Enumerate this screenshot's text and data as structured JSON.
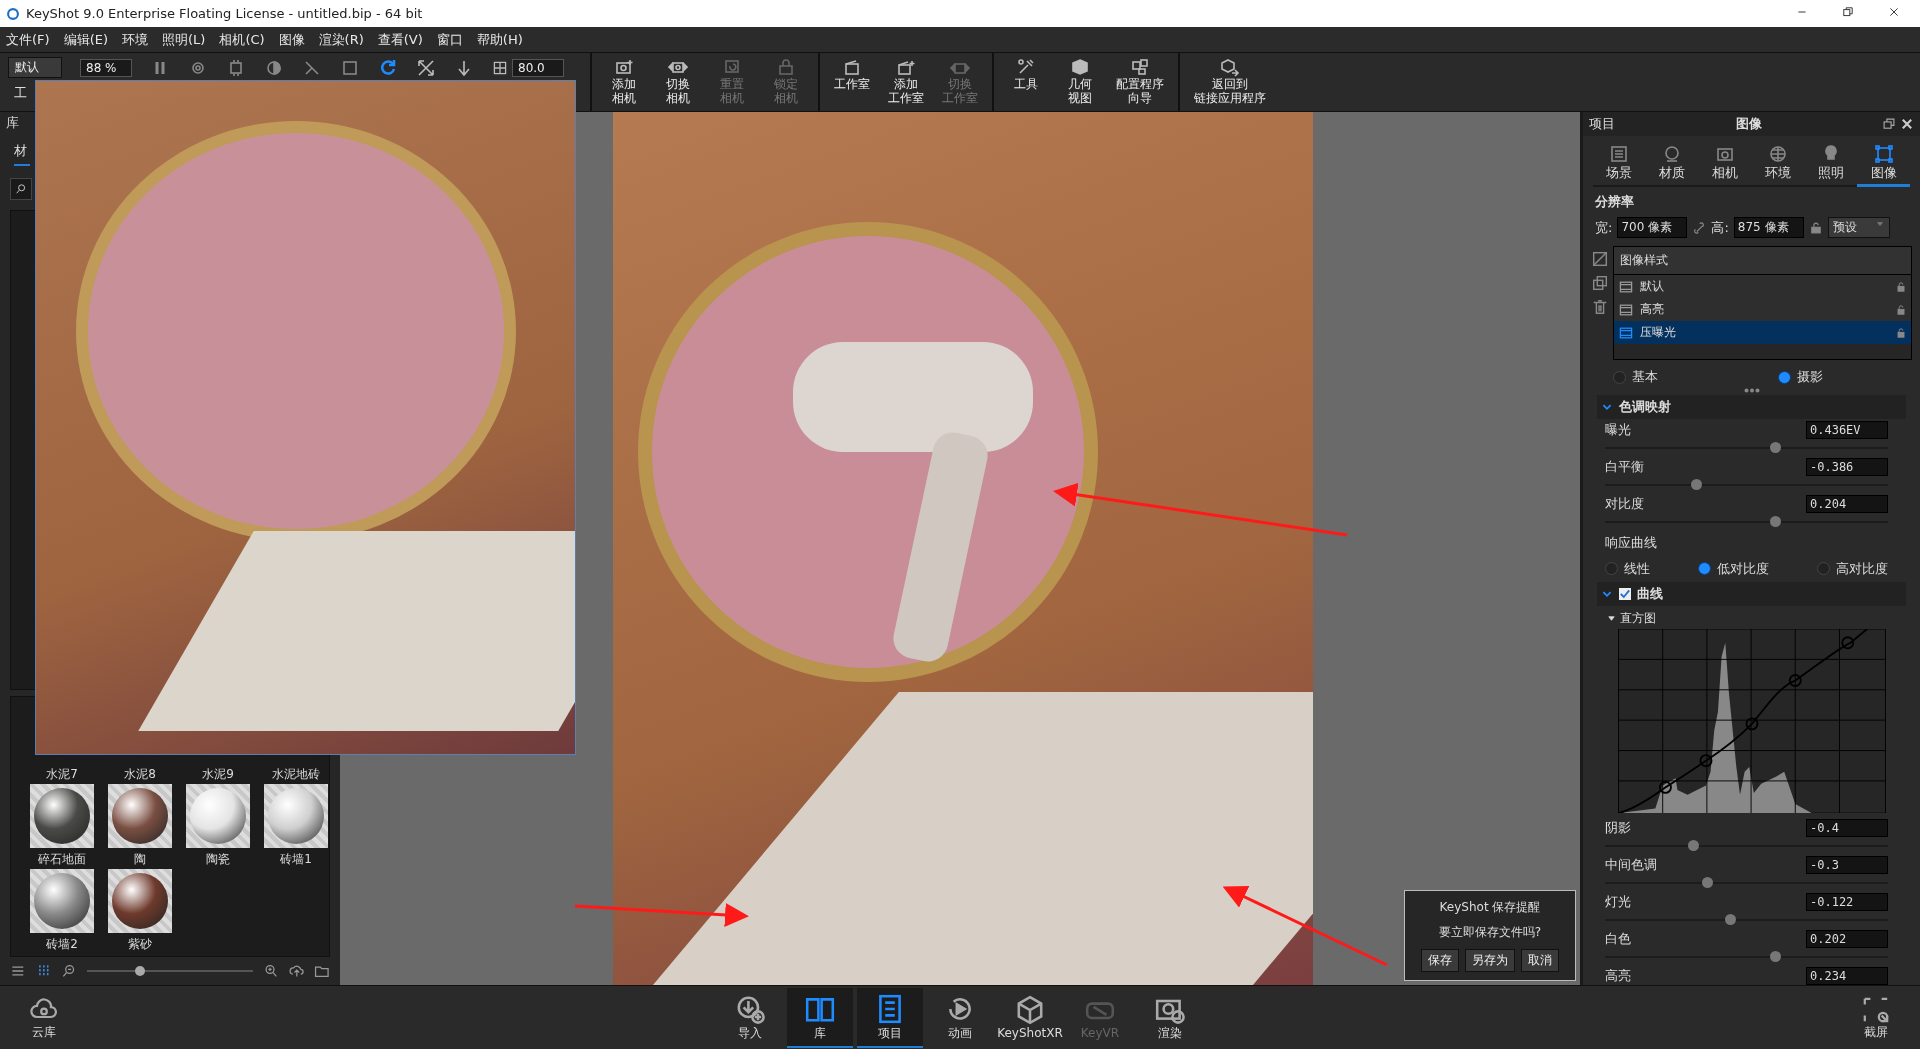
{
  "window": {
    "title": "KeyShot 9.0 Enterprise Floating License  - untitled.bip  - 64 bit"
  },
  "menu": [
    {
      "label": "文件(F)"
    },
    {
      "label": "编辑(E)"
    },
    {
      "label": "环境"
    },
    {
      "label": "照明(L)"
    },
    {
      "label": "相机(C)"
    },
    {
      "label": "图像"
    },
    {
      "label": "渲染(R)"
    },
    {
      "label": "查看(V)"
    },
    {
      "label": "窗口"
    },
    {
      "label": "帮助(H)"
    }
  ],
  "toolbar": {
    "style_dropdown": "默认",
    "zoom_field": "88 %",
    "left_label": "工",
    "grid_field": "80.0",
    "buttons": [
      {
        "lines": [
          "添加",
          "相机"
        ],
        "disabled": false
      },
      {
        "lines": [
          "切换",
          "相机"
        ],
        "disabled": false
      },
      {
        "lines": [
          "重置",
          "相机"
        ],
        "disabled": true
      },
      {
        "lines": [
          "锁定",
          "相机"
        ],
        "disabled": true
      },
      {
        "lines": [
          "工作室"
        ],
        "disabled": false
      },
      {
        "lines": [
          "添加",
          "工作室"
        ],
        "disabled": false
      },
      {
        "lines": [
          "切换",
          "工作室"
        ],
        "disabled": true
      },
      {
        "lines": [
          "工具"
        ],
        "disabled": false
      },
      {
        "lines": [
          "几何",
          "视图"
        ],
        "disabled": false
      },
      {
        "lines": [
          "配置程序",
          "向导"
        ],
        "disabled": false
      },
      {
        "lines": [
          "返回到",
          "链接应用程序"
        ],
        "disabled": false
      }
    ]
  },
  "library": {
    "title": "库",
    "tab": {
      "label": "材",
      "selected": true
    },
    "zoom_slider": {
      "level": 0.3
    },
    "materials": [
      {
        "label": "水泥7"
      },
      {
        "label": "水泥8"
      },
      {
        "label": "水泥9"
      },
      {
        "label": "水泥地砖"
      },
      {
        "label": "碎石地面"
      },
      {
        "label": "陶"
      },
      {
        "label": "陶瓷"
      },
      {
        "label": "砖墙1"
      },
      {
        "label": "砖墙2"
      },
      {
        "label": "紫砂"
      }
    ]
  },
  "save_dialog": {
    "title": "KeyShot 保存提醒",
    "message": "要立即保存文件吗?",
    "buttons": [
      {
        "label": "保存"
      },
      {
        "label": "另存为"
      },
      {
        "label": "取消"
      }
    ]
  },
  "project_panel": {
    "title": "项目",
    "subtitle": "图像",
    "tabs": [
      {
        "label": "场景",
        "selected": false
      },
      {
        "label": "材质",
        "selected": false
      },
      {
        "label": "相机",
        "selected": false
      },
      {
        "label": "环境",
        "selected": false
      },
      {
        "label": "照明",
        "selected": false
      },
      {
        "label": "图像",
        "selected": true
      }
    ],
    "resolution": {
      "title": "分辨率",
      "width_label": "宽:",
      "width": "700 像素",
      "height_label": "高:",
      "height": "875 像素",
      "preset": "预设"
    },
    "image_styles": {
      "header": "图像样式",
      "items": [
        {
          "label": "默认",
          "selected": false
        },
        {
          "label": "高亮",
          "selected": false
        },
        {
          "label": "压曝光",
          "selected": true
        }
      ]
    },
    "modes": [
      {
        "label": "基本",
        "selected": false
      },
      {
        "label": "摄影",
        "selected": true
      }
    ],
    "tone_mapping": {
      "title": "色调映射",
      "expanded": true,
      "sliders": [
        {
          "label": "曝光",
          "value": "0.436EV",
          "level": 0.6
        },
        {
          "label": "白平衡",
          "value": "-0.386",
          "level": 0.32
        },
        {
          "label": "对比度",
          "value": "0.204",
          "level": 0.6
        }
      ],
      "response_curve": {
        "label": "响应曲线",
        "options": [
          {
            "label": "线性",
            "selected": false
          },
          {
            "label": "低对比度",
            "selected": true
          },
          {
            "label": "高对比度",
            "selected": false
          }
        ]
      }
    },
    "curves": {
      "title": "曲线",
      "checked": true,
      "expanded": true,
      "histogram": {
        "title": "直方图",
        "expanded": true
      },
      "sliders": [
        {
          "label": "阴影",
          "value": "-0.4",
          "level": 0.31
        },
        {
          "label": "中间色调",
          "value": "-0.3",
          "level": 0.36
        },
        {
          "label": "灯光",
          "value": "-0.122",
          "level": 0.44
        },
        {
          "label": "白色",
          "value": "0.202",
          "level": 0.6
        },
        {
          "label": "高亮",
          "value": "0.234"
        }
      ]
    }
  },
  "dock": {
    "left": {
      "label": "云库"
    },
    "items": [
      {
        "label": "导入",
        "selected": false,
        "disabled": false
      },
      {
        "label": "库",
        "selected": true,
        "disabled": false
      },
      {
        "label": "项目",
        "selected": true,
        "disabled": false
      },
      {
        "label": "动画",
        "selected": false,
        "disabled": false
      },
      {
        "label": "KeyShotXR",
        "selected": false,
        "disabled": false
      },
      {
        "label": "KeyVR",
        "selected": false,
        "disabled": true
      },
      {
        "label": "渲染",
        "selected": false,
        "disabled": false
      }
    ],
    "right": {
      "label": "截屏"
    }
  }
}
